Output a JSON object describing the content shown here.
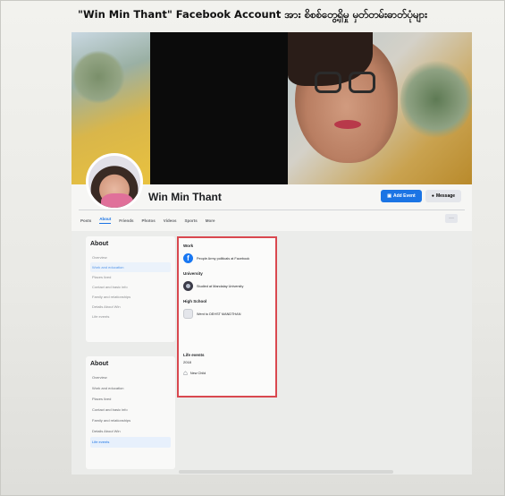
{
  "caption": "\"Win Min Thant\" Facebook Account အား စိစစ်တွေ့ရှိမှု မှတ်တမ်းဓာတ်ပုံများ",
  "profile": {
    "name": "Win Min Thant",
    "add_event_label": "Add Event",
    "message_label": "Message"
  },
  "tabs": [
    "Posts",
    "About",
    "Friends",
    "Photos",
    "Videos",
    "Sports",
    "More"
  ],
  "tab_more_label": "···",
  "about_sidebar_1": {
    "heading": "About",
    "items": [
      "Overview",
      "Work and education",
      "Places lived",
      "Contact and basic info",
      "Family and relationships",
      "Details About Win",
      "Life events"
    ]
  },
  "about_sidebar_2": {
    "heading": "About",
    "items": [
      "Overview",
      "Work and education",
      "Places lived",
      "Contact and basic info",
      "Family and relationships",
      "Details About Win",
      "Life events"
    ]
  },
  "main": {
    "work_title": "Work",
    "work_entry": "People Army politicals at Facebook",
    "university_title": "University",
    "university_entry": "Studied at Mandalay University",
    "high_school_title": "High School",
    "high_school_entry": "Went to DEHST MANDTHAN",
    "life_events_title": "Life events",
    "life_year": "2018",
    "life_entry": "New Child"
  }
}
